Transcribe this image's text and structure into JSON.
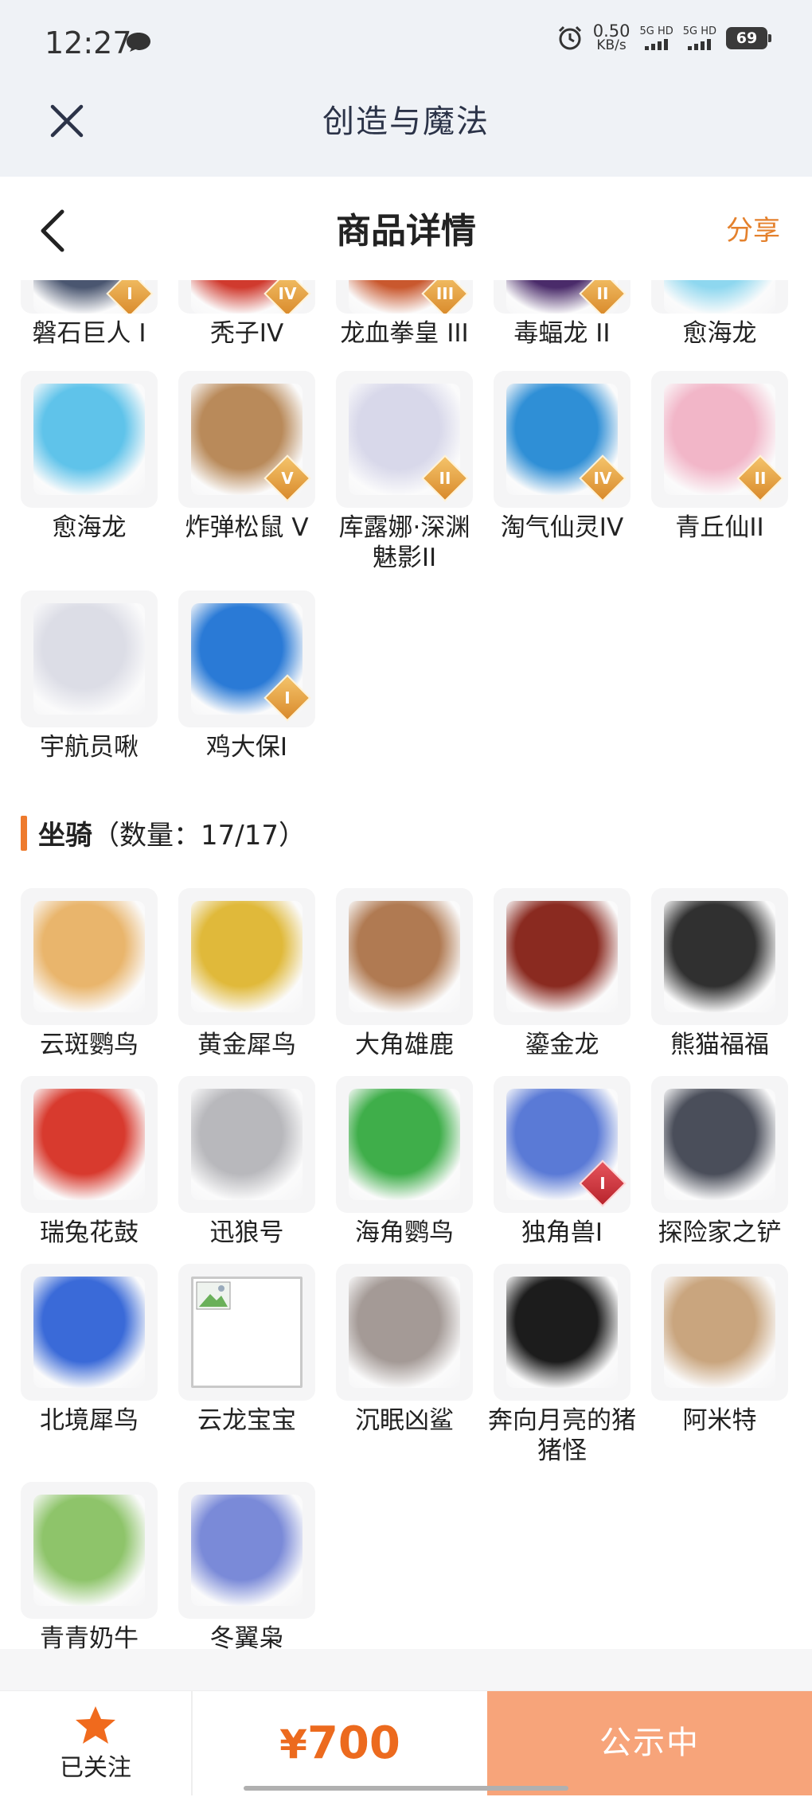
{
  "status_bar": {
    "time": "12:27",
    "speed_value": "0.50",
    "speed_unit": "KB/s",
    "sim1": "5G HD",
    "sim2": "5G HD",
    "battery": "69"
  },
  "app_bar": {
    "title": "创造与魔法"
  },
  "nav": {
    "title": "商品详情",
    "share_label": "分享"
  },
  "partial_row": [
    {
      "name": "磐石巨人 I",
      "badge": "I",
      "color": "#4a5670"
    },
    {
      "name": "秃子IV",
      "badge": "IV",
      "color": "#d03a2e"
    },
    {
      "name": "龙血拳皇 III",
      "badge": "III",
      "color": "#c9582e"
    },
    {
      "name": "毒蝠龙 II",
      "badge": "II",
      "color": "#4a2b6a"
    },
    {
      "name": "愈海龙",
      "badge": "",
      "color": "#8ed7ef"
    }
  ],
  "pets": [
    {
      "name": "愈海龙",
      "badge": "",
      "color": "#5fc3ea"
    },
    {
      "name": "炸弹松鼠 V",
      "badge": "V",
      "color": "#b98a5a"
    },
    {
      "name": "库露娜·深渊魅影II",
      "badge": "II",
      "color": "#d8d8ea"
    },
    {
      "name": "淘气仙灵IV",
      "badge": "IV",
      "color": "#2f8fd6"
    },
    {
      "name": "青丘仙II",
      "badge": "II",
      "color": "#f2b6c8"
    },
    {
      "name": "宇航员啾",
      "badge": "",
      "color": "#dcdde6"
    },
    {
      "name": "鸡大保I",
      "badge": "I",
      "color": "#2a7ad6"
    }
  ],
  "mount_section": {
    "title": "坐骑",
    "count": "（数量：17/17）"
  },
  "mounts": [
    {
      "name": "云斑鹦鸟",
      "badge": "",
      "color": "#e9b56c"
    },
    {
      "name": "黄金犀鸟",
      "badge": "",
      "color": "#e0b93a"
    },
    {
      "name": "大角雄鹿",
      "badge": "",
      "color": "#b07a52"
    },
    {
      "name": "鎏金龙",
      "badge": "",
      "color": "#8a2a20"
    },
    {
      "name": "熊猫福福",
      "badge": "",
      "color": "#303030"
    },
    {
      "name": "瑞兔花鼓",
      "badge": "",
      "color": "#d83a2e"
    },
    {
      "name": "迅狼号",
      "badge": "",
      "color": "#b8b8bc"
    },
    {
      "name": "海角鹦鸟",
      "badge": "",
      "color": "#3fae4a"
    },
    {
      "name": "独角兽I",
      "badge": "I",
      "color": "#5a7ad6"
    },
    {
      "name": "探险家之铲",
      "badge": "",
      "color": "#4a4e5a"
    },
    {
      "name": "北境犀鸟",
      "badge": "",
      "color": "#3a6ad8"
    },
    {
      "name": "云龙宝宝",
      "badge": "",
      "color": "#ffffff"
    },
    {
      "name": "沉眠凶鲨",
      "badge": "",
      "color": "#a49a96"
    },
    {
      "name": "奔向月亮的猪猪怪",
      "badge": "",
      "color": "#1c1c1c"
    },
    {
      "name": "阿米特",
      "badge": "",
      "color": "#c9a57e"
    },
    {
      "name": "青青奶牛",
      "badge": "",
      "color": "#8ec46a"
    },
    {
      "name": "冬翼枭",
      "badge": "",
      "color": "#7a8ad8"
    }
  ],
  "bottom_bar": {
    "follow_label": "已关注",
    "currency": "¥",
    "price": "700",
    "status_label": "公示中"
  },
  "colors": {
    "accent": "#ec6a1e",
    "share": "#e4812d",
    "status_button": "#f7a47a"
  }
}
